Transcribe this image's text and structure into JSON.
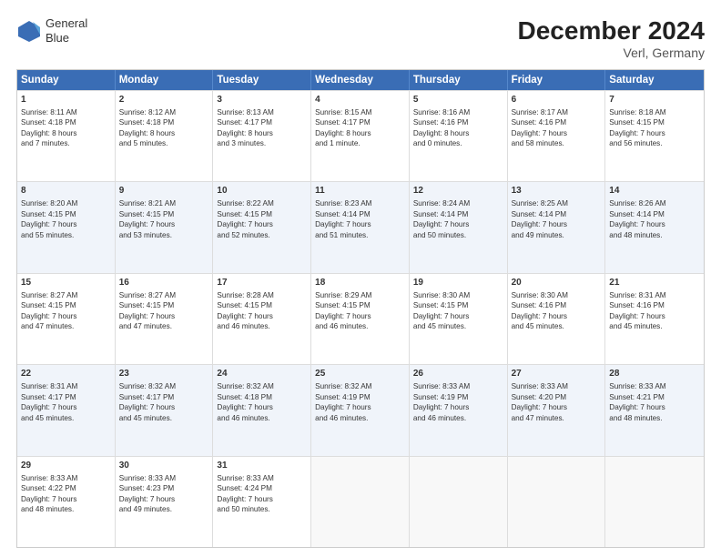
{
  "header": {
    "logo_line1": "General",
    "logo_line2": "Blue",
    "title": "December 2024",
    "subtitle": "Verl, Germany"
  },
  "weekdays": [
    "Sunday",
    "Monday",
    "Tuesday",
    "Wednesday",
    "Thursday",
    "Friday",
    "Saturday"
  ],
  "rows": [
    [
      {
        "day": "1",
        "lines": [
          "Sunrise: 8:11 AM",
          "Sunset: 4:18 PM",
          "Daylight: 8 hours",
          "and 7 minutes."
        ]
      },
      {
        "day": "2",
        "lines": [
          "Sunrise: 8:12 AM",
          "Sunset: 4:18 PM",
          "Daylight: 8 hours",
          "and 5 minutes."
        ]
      },
      {
        "day": "3",
        "lines": [
          "Sunrise: 8:13 AM",
          "Sunset: 4:17 PM",
          "Daylight: 8 hours",
          "and 3 minutes."
        ]
      },
      {
        "day": "4",
        "lines": [
          "Sunrise: 8:15 AM",
          "Sunset: 4:17 PM",
          "Daylight: 8 hours",
          "and 1 minute."
        ]
      },
      {
        "day": "5",
        "lines": [
          "Sunrise: 8:16 AM",
          "Sunset: 4:16 PM",
          "Daylight: 8 hours",
          "and 0 minutes."
        ]
      },
      {
        "day": "6",
        "lines": [
          "Sunrise: 8:17 AM",
          "Sunset: 4:16 PM",
          "Daylight: 7 hours",
          "and 58 minutes."
        ]
      },
      {
        "day": "7",
        "lines": [
          "Sunrise: 8:18 AM",
          "Sunset: 4:15 PM",
          "Daylight: 7 hours",
          "and 56 minutes."
        ]
      }
    ],
    [
      {
        "day": "8",
        "lines": [
          "Sunrise: 8:20 AM",
          "Sunset: 4:15 PM",
          "Daylight: 7 hours",
          "and 55 minutes."
        ]
      },
      {
        "day": "9",
        "lines": [
          "Sunrise: 8:21 AM",
          "Sunset: 4:15 PM",
          "Daylight: 7 hours",
          "and 53 minutes."
        ]
      },
      {
        "day": "10",
        "lines": [
          "Sunrise: 8:22 AM",
          "Sunset: 4:15 PM",
          "Daylight: 7 hours",
          "and 52 minutes."
        ]
      },
      {
        "day": "11",
        "lines": [
          "Sunrise: 8:23 AM",
          "Sunset: 4:14 PM",
          "Daylight: 7 hours",
          "and 51 minutes."
        ]
      },
      {
        "day": "12",
        "lines": [
          "Sunrise: 8:24 AM",
          "Sunset: 4:14 PM",
          "Daylight: 7 hours",
          "and 50 minutes."
        ]
      },
      {
        "day": "13",
        "lines": [
          "Sunrise: 8:25 AM",
          "Sunset: 4:14 PM",
          "Daylight: 7 hours",
          "and 49 minutes."
        ]
      },
      {
        "day": "14",
        "lines": [
          "Sunrise: 8:26 AM",
          "Sunset: 4:14 PM",
          "Daylight: 7 hours",
          "and 48 minutes."
        ]
      }
    ],
    [
      {
        "day": "15",
        "lines": [
          "Sunrise: 8:27 AM",
          "Sunset: 4:15 PM",
          "Daylight: 7 hours",
          "and 47 minutes."
        ]
      },
      {
        "day": "16",
        "lines": [
          "Sunrise: 8:27 AM",
          "Sunset: 4:15 PM",
          "Daylight: 7 hours",
          "and 47 minutes."
        ]
      },
      {
        "day": "17",
        "lines": [
          "Sunrise: 8:28 AM",
          "Sunset: 4:15 PM",
          "Daylight: 7 hours",
          "and 46 minutes."
        ]
      },
      {
        "day": "18",
        "lines": [
          "Sunrise: 8:29 AM",
          "Sunset: 4:15 PM",
          "Daylight: 7 hours",
          "and 46 minutes."
        ]
      },
      {
        "day": "19",
        "lines": [
          "Sunrise: 8:30 AM",
          "Sunset: 4:15 PM",
          "Daylight: 7 hours",
          "and 45 minutes."
        ]
      },
      {
        "day": "20",
        "lines": [
          "Sunrise: 8:30 AM",
          "Sunset: 4:16 PM",
          "Daylight: 7 hours",
          "and 45 minutes."
        ]
      },
      {
        "day": "21",
        "lines": [
          "Sunrise: 8:31 AM",
          "Sunset: 4:16 PM",
          "Daylight: 7 hours",
          "and 45 minutes."
        ]
      }
    ],
    [
      {
        "day": "22",
        "lines": [
          "Sunrise: 8:31 AM",
          "Sunset: 4:17 PM",
          "Daylight: 7 hours",
          "and 45 minutes."
        ]
      },
      {
        "day": "23",
        "lines": [
          "Sunrise: 8:32 AM",
          "Sunset: 4:17 PM",
          "Daylight: 7 hours",
          "and 45 minutes."
        ]
      },
      {
        "day": "24",
        "lines": [
          "Sunrise: 8:32 AM",
          "Sunset: 4:18 PM",
          "Daylight: 7 hours",
          "and 46 minutes."
        ]
      },
      {
        "day": "25",
        "lines": [
          "Sunrise: 8:32 AM",
          "Sunset: 4:19 PM",
          "Daylight: 7 hours",
          "and 46 minutes."
        ]
      },
      {
        "day": "26",
        "lines": [
          "Sunrise: 8:33 AM",
          "Sunset: 4:19 PM",
          "Daylight: 7 hours",
          "and 46 minutes."
        ]
      },
      {
        "day": "27",
        "lines": [
          "Sunrise: 8:33 AM",
          "Sunset: 4:20 PM",
          "Daylight: 7 hours",
          "and 47 minutes."
        ]
      },
      {
        "day": "28",
        "lines": [
          "Sunrise: 8:33 AM",
          "Sunset: 4:21 PM",
          "Daylight: 7 hours",
          "and 48 minutes."
        ]
      }
    ],
    [
      {
        "day": "29",
        "lines": [
          "Sunrise: 8:33 AM",
          "Sunset: 4:22 PM",
          "Daylight: 7 hours",
          "and 48 minutes."
        ]
      },
      {
        "day": "30",
        "lines": [
          "Sunrise: 8:33 AM",
          "Sunset: 4:23 PM",
          "Daylight: 7 hours",
          "and 49 minutes."
        ]
      },
      {
        "day": "31",
        "lines": [
          "Sunrise: 8:33 AM",
          "Sunset: 4:24 PM",
          "Daylight: 7 hours",
          "and 50 minutes."
        ]
      },
      {
        "day": "",
        "lines": []
      },
      {
        "day": "",
        "lines": []
      },
      {
        "day": "",
        "lines": []
      },
      {
        "day": "",
        "lines": []
      }
    ]
  ]
}
